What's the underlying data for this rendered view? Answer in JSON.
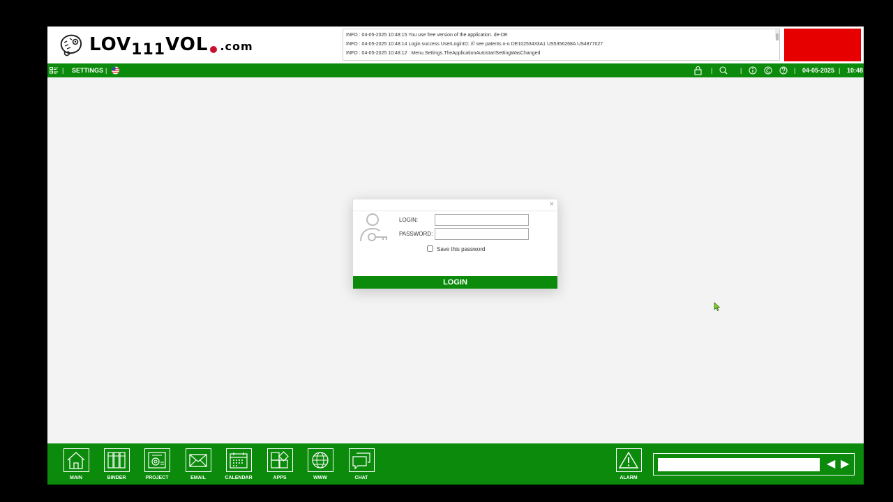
{
  "brand": {
    "logo_part1": "LOV",
    "logo_part2": "111",
    "logo_part3": "VOL",
    "logo_part4": ".com"
  },
  "log": {
    "lines": [
      "INFO : 04-05-2025 10:48:15 You use free version of the application. de-DE",
      "INFO : 04-05-2025 10:48:14 Login success UserLoginID:  /// see patents o-o DE10253433A1 US5356268A US4877027",
      "INFO : 04-05-2025 10:48:12 : Menu.Settings.TheApplicationAutostartSettingWasChanged"
    ]
  },
  "menubar": {
    "separator": "|",
    "settings_label": "SETTINGS",
    "date": "04-05-2025",
    "time": "10:48"
  },
  "login_dialog": {
    "close_glyph": "×",
    "login_label": "LOGIN:",
    "login_value": "",
    "password_label": "PASSWORD:",
    "password_value": "",
    "save_password_label": "Save this password",
    "save_password_checked": false,
    "login_button": "LOGIN"
  },
  "footer": {
    "buttons": [
      {
        "label": "MAIN",
        "icon": "home-icon"
      },
      {
        "label": "BINDER",
        "icon": "binder-icon"
      },
      {
        "label": "PROJECT",
        "icon": "project-icon"
      },
      {
        "label": "EMAIL",
        "icon": "email-icon"
      },
      {
        "label": "CALENDAR",
        "icon": "calendar-icon"
      },
      {
        "label": "APPS",
        "icon": "apps-icon"
      },
      {
        "label": "WWW",
        "icon": "globe-icon"
      },
      {
        "label": "CHAT",
        "icon": "chat-icon"
      }
    ],
    "alarm_label": "ALARM",
    "input_value": "",
    "prev_glyph": "◀",
    "next_glyph": "▶"
  },
  "colors": {
    "accent_green": "#0c8a0c",
    "alert_red": "#e60000"
  }
}
